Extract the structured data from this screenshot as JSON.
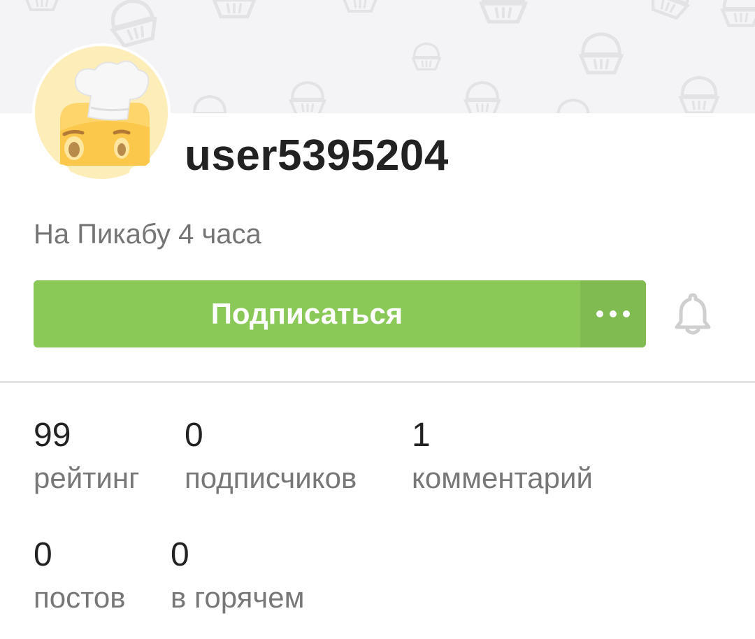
{
  "banner": {
    "pattern_icon": "cupcake-icon",
    "color": "#f4f4f6"
  },
  "profile": {
    "avatar_icon": "chef-bread-avatar",
    "username": "user5395204",
    "since": "На Пикабу 4 часа"
  },
  "actions": {
    "subscribe_label": "Подписаться",
    "more_label": "•••",
    "bell_icon": "bell-icon",
    "accent_color": "#8ac858"
  },
  "stats": [
    {
      "value": "99",
      "label": "рейтинг"
    },
    {
      "value": "0",
      "label": "подписчиков"
    },
    {
      "value": "1",
      "label": "комментарий"
    },
    {
      "value": "0",
      "label": "постов"
    },
    {
      "value": "0",
      "label": "в горячем"
    }
  ]
}
